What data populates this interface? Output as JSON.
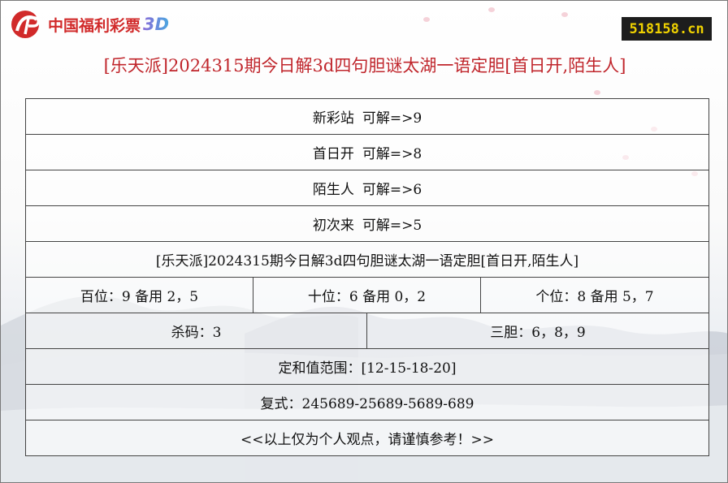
{
  "brand": {
    "logo_text": "中国福利彩票",
    "logo_3d": "3D",
    "site_badge": "518158.cn"
  },
  "title": "[乐天派]2024315期今日解3d四句胆谜太湖一语定胆[首日开,陌生人]",
  "riddles": [
    {
      "word": "新彩站",
      "answer": "可解=>9"
    },
    {
      "word": "首日开",
      "answer": "可解=>8"
    },
    {
      "word": "陌生人",
      "answer": "可解=>6"
    },
    {
      "word": "初次来",
      "answer": "可解=>5"
    }
  ],
  "summary_title": "[乐天派]2024315期今日解3d四句胆谜太湖一语定胆[首日开,陌生人]",
  "positions": {
    "hundreds": "百位：9 备用 2，5",
    "tens": "十位：6 备用 0，2",
    "units": "个位：8 备用 5，7"
  },
  "kill_code": "杀码：3",
  "three_dan": "三胆：6，8，9",
  "sum_range": "定和值范围：[12-15-18-20]",
  "compound": "复式：245689-25689-5689-689",
  "disclaimer": "<<以上仅为个人观点，请谨慎参考！>>",
  "colors": {
    "title_red": "#c0262c",
    "logo_red": "#d12a2a",
    "badge_bg": "#1d1d1d",
    "badge_text": "#f0d200"
  }
}
